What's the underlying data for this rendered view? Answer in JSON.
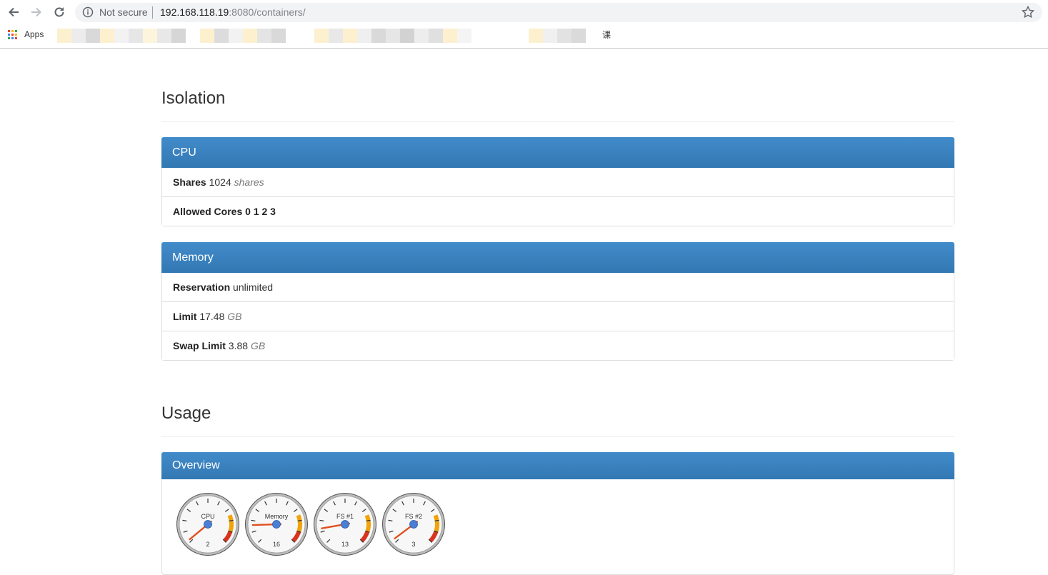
{
  "browser": {
    "security_label": "Not secure",
    "url_host": "192.168.118.19",
    "url_rest": ":8080/containers/",
    "apps_label": "Apps",
    "bookmark_trailing_char": "课"
  },
  "isolation": {
    "title": "Isolation",
    "cpu": {
      "heading": "CPU",
      "shares_label": "Shares",
      "shares_value": "1024",
      "shares_unit": "shares",
      "cores_label": "Allowed Cores",
      "cores_value": "0 1 2 3"
    },
    "memory": {
      "heading": "Memory",
      "reservation_label": "Reservation",
      "reservation_value": "unlimited",
      "limit_label": "Limit",
      "limit_value": "17.48",
      "limit_unit": "GB",
      "swap_label": "Swap Limit",
      "swap_value": "3.88",
      "swap_unit": "GB"
    }
  },
  "usage": {
    "title": "Usage",
    "overview_heading": "Overview",
    "gauges": [
      {
        "label": "CPU",
        "value": "2"
      },
      {
        "label": "Memory",
        "value": "16"
      },
      {
        "label": "FS #1",
        "value": "13"
      },
      {
        "label": "FS #2",
        "value": "3"
      }
    ]
  },
  "colors": {
    "panel_header": "#3a84c1",
    "gauge_warn": "#f0a30a",
    "gauge_danger": "#d9331f",
    "needle": "#e05020",
    "hub": "#4a7fd4"
  }
}
